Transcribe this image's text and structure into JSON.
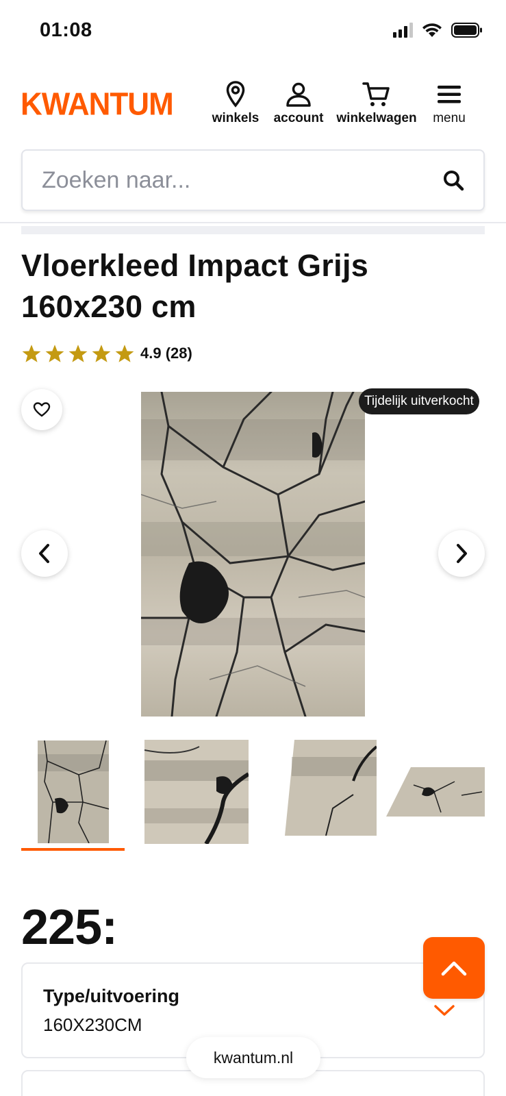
{
  "status_bar": {
    "time": "01:08"
  },
  "header": {
    "logo": "KWANTUM",
    "nav": [
      {
        "label": "winkels",
        "icon": "location-pin-icon"
      },
      {
        "label": "account",
        "icon": "user-icon"
      },
      {
        "label": "winkelwagen",
        "icon": "cart-icon"
      },
      {
        "label": "menu",
        "icon": "hamburger-menu-icon"
      }
    ]
  },
  "search": {
    "placeholder": "Zoeken naar...",
    "icon": "search-icon"
  },
  "product": {
    "title_line1": "Vloerkleed Impact Grijs",
    "title_line2": "160x230 cm",
    "rating_stars": 5,
    "rating_text": "4.9 (28)",
    "badge": "Tijdelijk uitverkocht",
    "price": "225:",
    "variant_label": "Type/uitvoering",
    "variant_value": "160X230CM"
  },
  "gallery": {
    "thumbnails_count": 4,
    "selected_index": 0
  },
  "colors": {
    "brand": "#ff5a00",
    "star": "#c49a12",
    "badge_bg": "#1c1c1c"
  },
  "browser": {
    "url": "kwantum.nl"
  }
}
